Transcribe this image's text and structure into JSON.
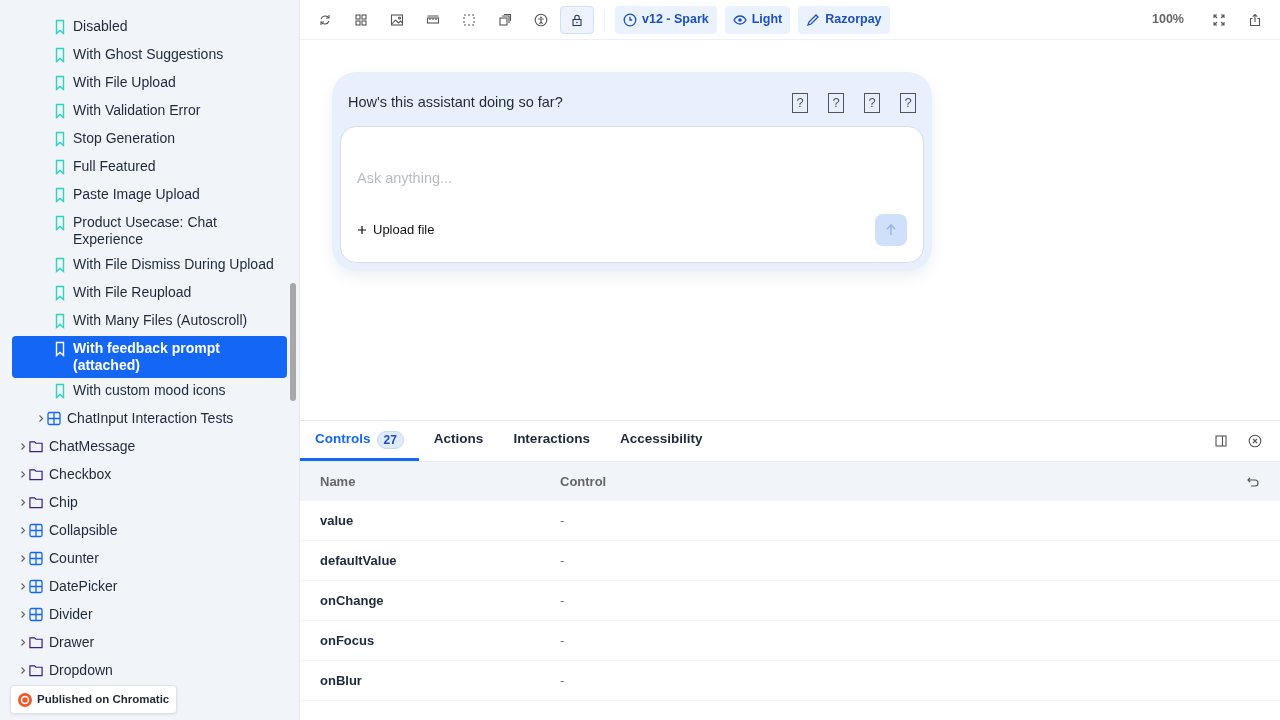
{
  "sidebar": {
    "stories": [
      {
        "label": "Disabled",
        "kind": "story",
        "selected": false
      },
      {
        "label": "With Ghost Suggestions",
        "kind": "story",
        "selected": false
      },
      {
        "label": "With File Upload",
        "kind": "story",
        "selected": false
      },
      {
        "label": "With Validation Error",
        "kind": "story",
        "selected": false
      },
      {
        "label": "Stop Generation",
        "kind": "story",
        "selected": false
      },
      {
        "label": "Full Featured",
        "kind": "story",
        "selected": false
      },
      {
        "label": "Paste Image Upload",
        "kind": "story",
        "selected": false
      },
      {
        "label": "Product Usecase: Chat Experience",
        "kind": "story",
        "selected": false
      },
      {
        "label": "With File Dismiss During Upload",
        "kind": "story",
        "selected": false
      },
      {
        "label": "With File Reupload",
        "kind": "story",
        "selected": false
      },
      {
        "label": "With Many Files (Autoscroll)",
        "kind": "story",
        "selected": false
      },
      {
        "label": "With feedback prompt (attached)",
        "kind": "story",
        "selected": true
      },
      {
        "label": "With custom mood icons",
        "kind": "story",
        "selected": false
      },
      {
        "label": "ChatInput Interaction Tests",
        "kind": "component",
        "selected": false,
        "expanded": false
      }
    ],
    "components": [
      {
        "label": "ChatMessage",
        "kind": "folder",
        "expanded": false
      },
      {
        "label": "Checkbox",
        "kind": "folder",
        "expanded": false
      },
      {
        "label": "Chip",
        "kind": "folder",
        "expanded": false
      },
      {
        "label": "Collapsible",
        "kind": "component",
        "expanded": false
      },
      {
        "label": "Counter",
        "kind": "component",
        "expanded": false
      },
      {
        "label": "DatePicker",
        "kind": "component",
        "expanded": false
      },
      {
        "label": "Divider",
        "kind": "component",
        "expanded": false
      },
      {
        "label": "Drawer",
        "kind": "folder",
        "expanded": false
      },
      {
        "label": "Dropdown",
        "kind": "folder",
        "expanded": false
      }
    ]
  },
  "publish_badge": "Published on Chromatic",
  "toolbar": {
    "tools": [
      {
        "kind": "reload",
        "selected": false
      },
      {
        "kind": "grid",
        "selected": false
      },
      {
        "kind": "image",
        "selected": false
      },
      {
        "kind": "ruler",
        "selected": false
      },
      {
        "kind": "outline",
        "selected": false
      },
      {
        "kind": "layers",
        "selected": false
      },
      {
        "kind": "accessibility",
        "selected": false
      },
      {
        "kind": "lock",
        "selected": true
      }
    ],
    "chips": [
      {
        "kind": "clock",
        "label": "v12 - Spark"
      },
      {
        "kind": "eye",
        "label": "Light"
      },
      {
        "kind": "brush",
        "label": "Razorpay"
      }
    ],
    "zoom": "100%"
  },
  "preview": {
    "feedback_prompt": "How's this assistant doing so far?",
    "mood_icons": [
      "?",
      "?",
      "?",
      "?"
    ],
    "placeholder": "Ask anything...",
    "upload_label": "Upload file",
    "send_disabled": true
  },
  "panel": {
    "tabs": [
      {
        "label": "Controls",
        "count": "27",
        "selected": true
      },
      {
        "label": "Actions",
        "selected": false
      },
      {
        "label": "Interactions",
        "selected": false
      },
      {
        "label": "Accessibility",
        "selected": false
      }
    ],
    "table": {
      "columns": [
        "Name",
        "Control"
      ],
      "rows": [
        {
          "name": "value",
          "control": "-"
        },
        {
          "name": "defaultValue",
          "control": "-"
        },
        {
          "name": "onChange",
          "control": "-"
        },
        {
          "name": "onFocus",
          "control": "-"
        },
        {
          "name": "onBlur",
          "control": "-"
        }
      ]
    }
  }
}
